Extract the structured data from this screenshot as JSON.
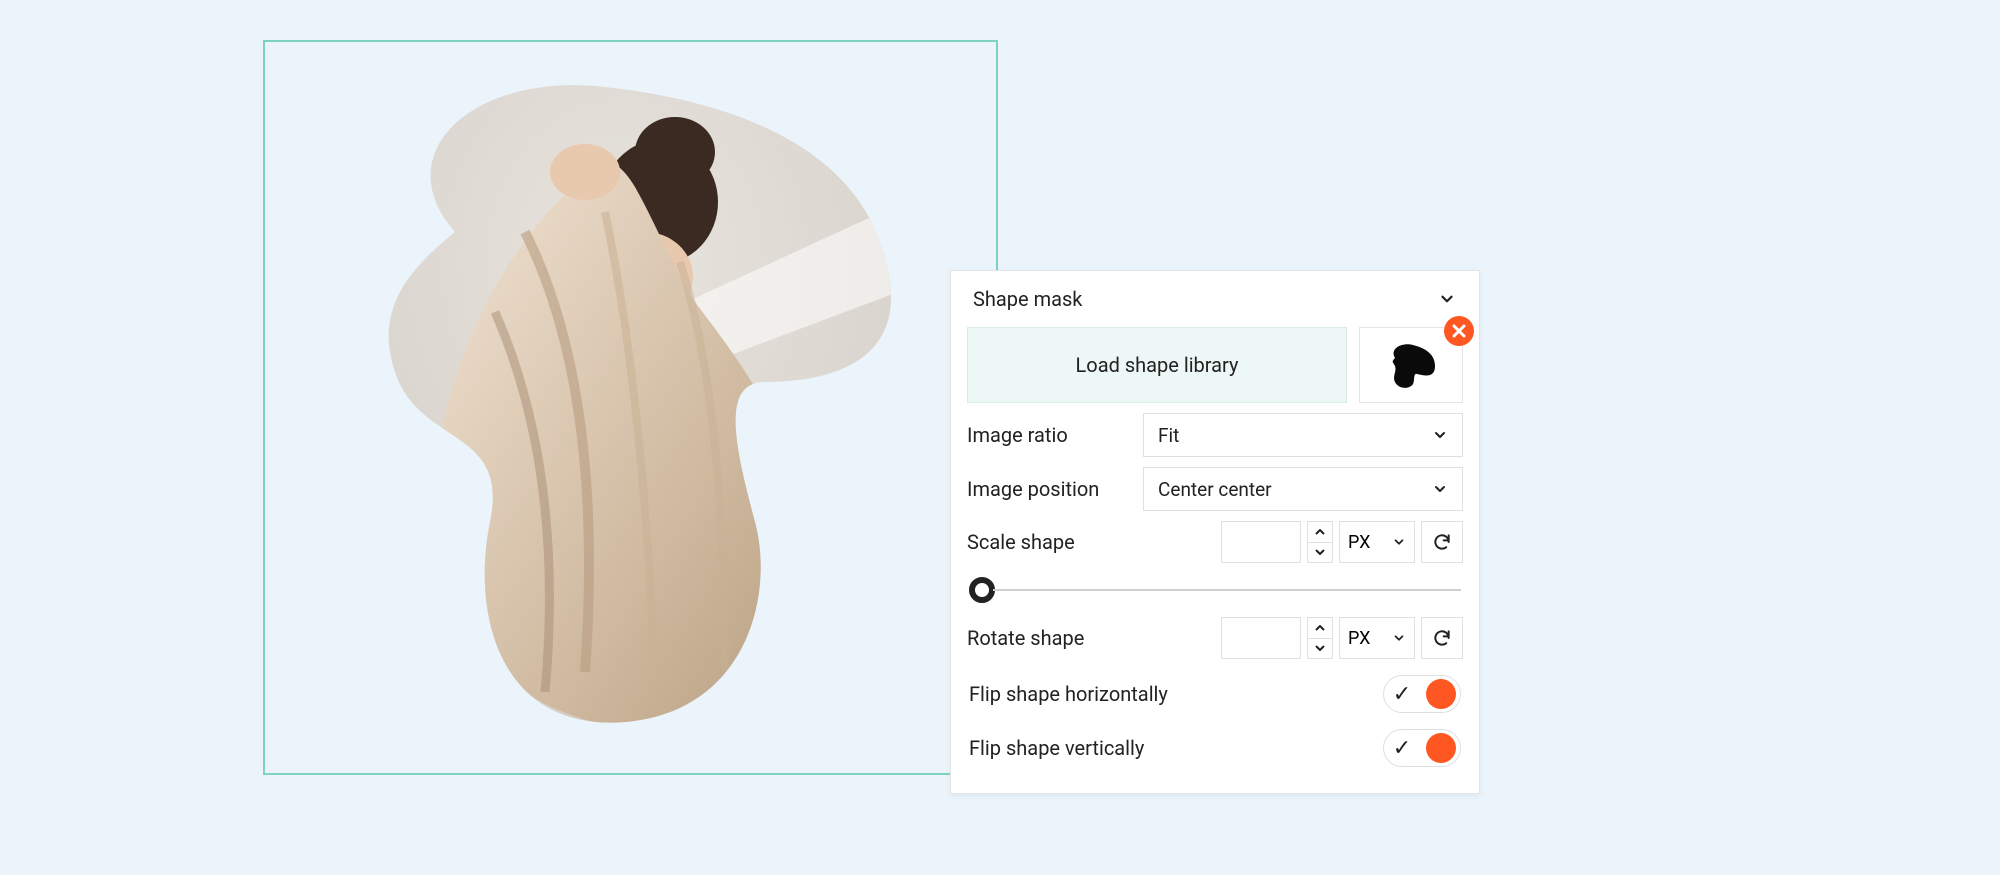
{
  "panel": {
    "title": "Shape mask",
    "load_button": "Load shape library",
    "image_ratio": {
      "label": "Image ratio",
      "value": "Fit"
    },
    "image_position": {
      "label": "Image position",
      "value": "Center center"
    },
    "scale": {
      "label": "Scale shape",
      "value": "",
      "unit": "PX"
    },
    "rotate": {
      "label": "Rotate shape",
      "value": "",
      "unit": "PX"
    },
    "flip_h": {
      "label": "Flip shape horizontally",
      "on": true
    },
    "flip_v": {
      "label": "Flip shape vertically",
      "on": true
    }
  },
  "colors": {
    "accent": "#ff5722",
    "panel_bg": "#ffffff",
    "page_bg": "#ebf3fb",
    "frame_border": "#7dd3c0",
    "load_bg": "#edf7f6"
  }
}
